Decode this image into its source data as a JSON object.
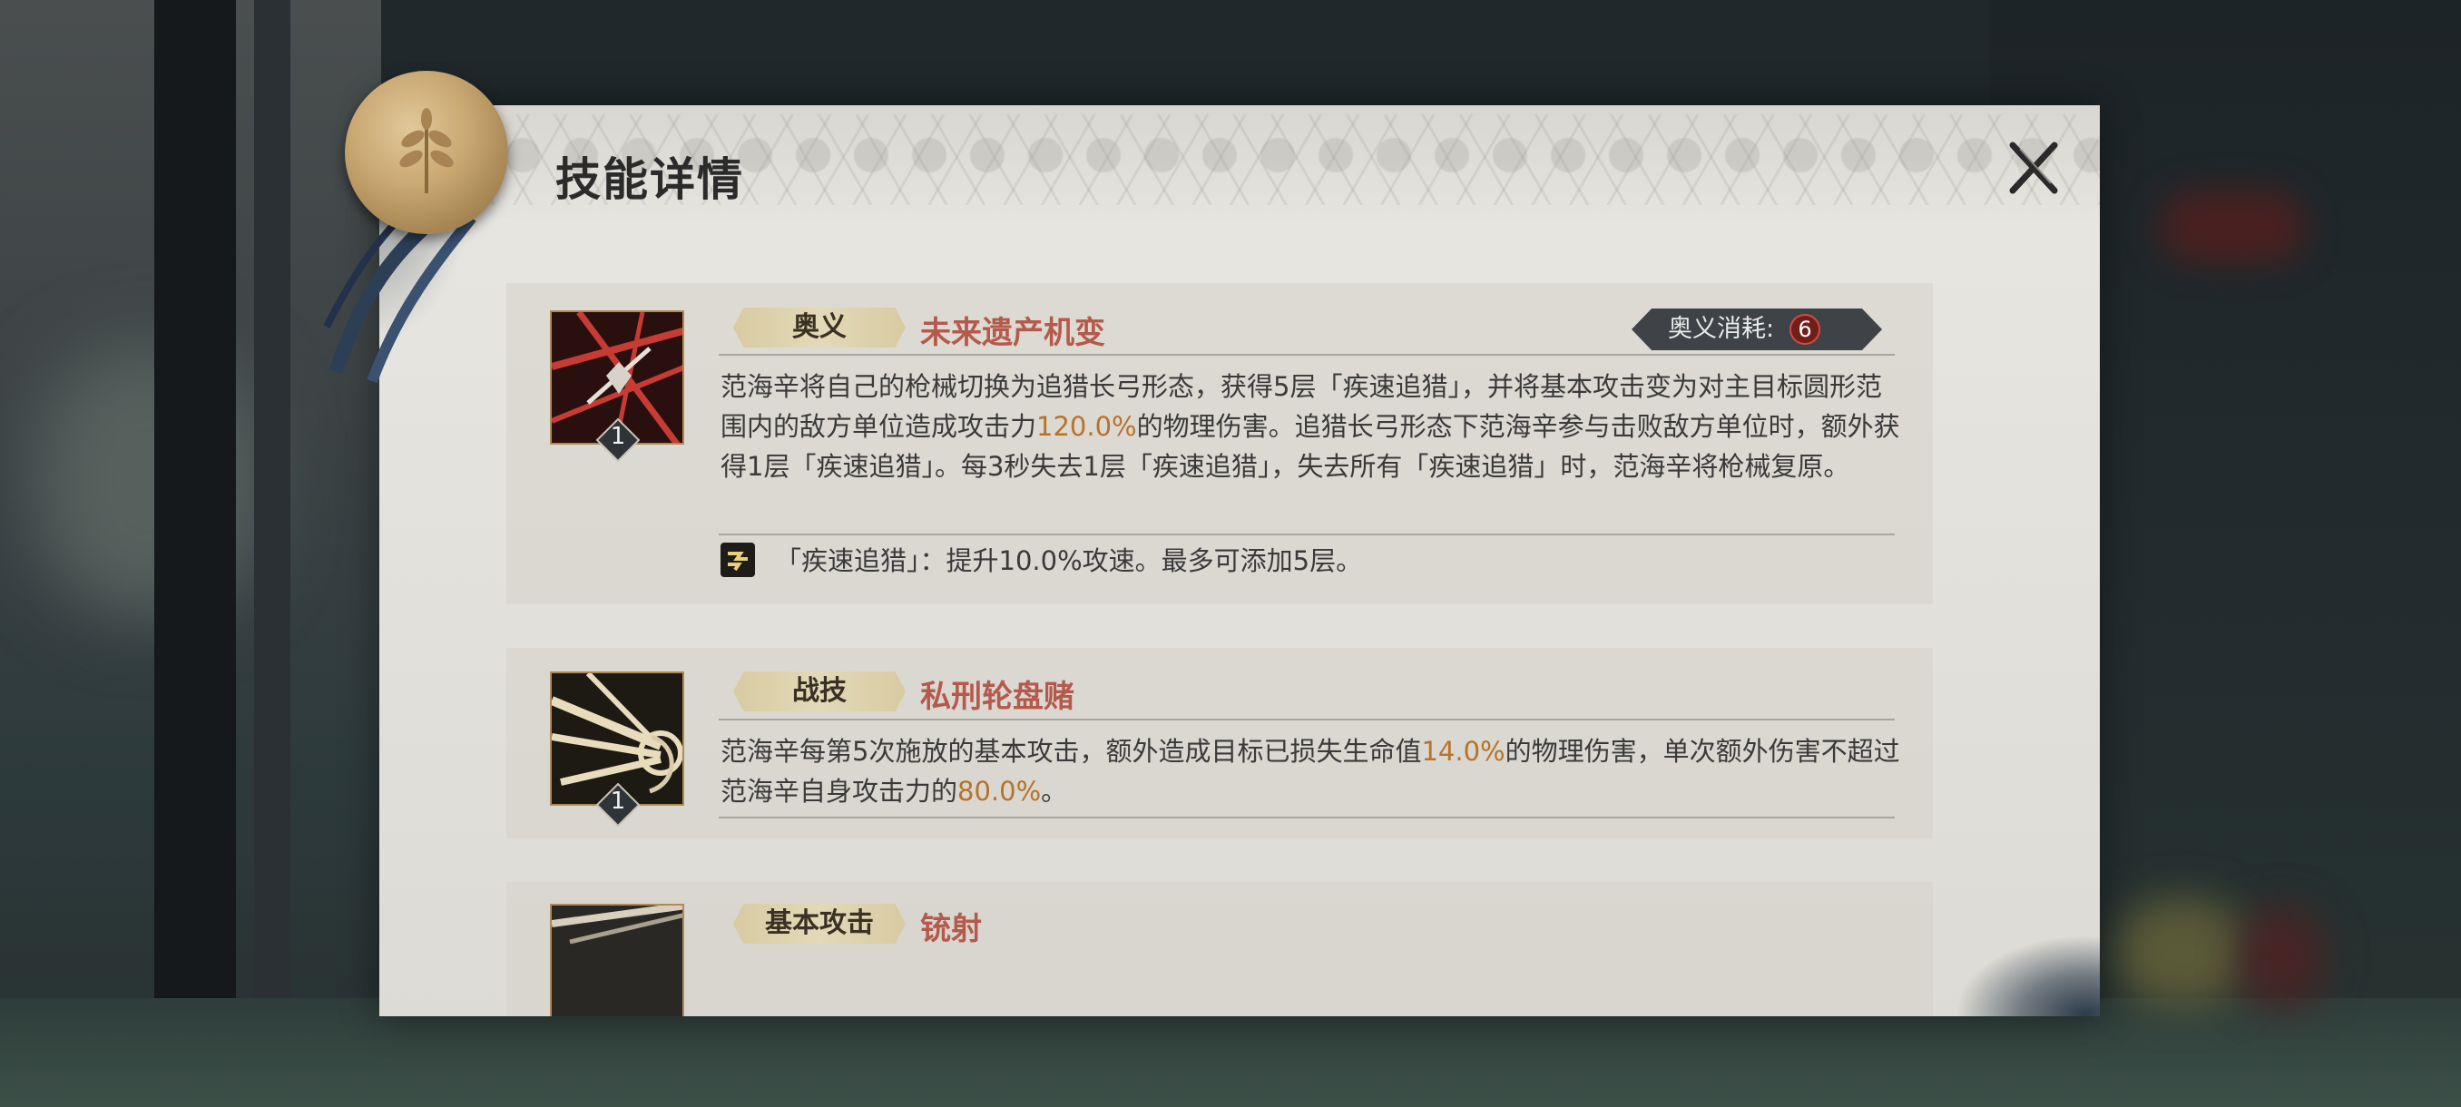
{
  "dialog": {
    "title": "技能详情"
  },
  "skills": [
    {
      "tag": "奥义",
      "name": "未来遗产机变",
      "level": "1",
      "cost_label": "奥义消耗:",
      "cost_value": "6",
      "desc_part1": "范海辛将自己的枪械切换为追猎长弓形态，获得5层「疾速追猎」，并将基本攻击变为对主目标圆形范围内的敌方单位造成攻击力",
      "desc_value1": "120.0%",
      "desc_part2": "的物理伤害。追猎长弓形态下范海辛参与击败敌方单位时，额外获得1层「疾速追猎」。每3秒失去1层「疾速追猎」，失去所有「疾速追猎」时，范海辛将枪械复原。",
      "buff_text": "「疾速追猎」：提升10.0%攻速。最多可添加5层。",
      "icon": "crossbow-skill-icon",
      "buff_icon": "speed-buff-icon"
    },
    {
      "tag": "战技",
      "name": "私刑轮盘赌",
      "level": "1",
      "desc_part1": "范海辛每第5次施放的基本攻击，额外造成目标已损失生命值",
      "desc_value1": "14.0%",
      "desc_part2": "的物理伤害，单次额外伤害不超过范海辛自身攻击力的",
      "desc_value2": "80.0%",
      "desc_part3": "。",
      "icon": "revolver-skill-icon"
    },
    {
      "tag": "基本攻击",
      "name": "铳射",
      "icon": "gunshot-skill-icon"
    }
  ],
  "colors": {
    "skill_name": "#b35a4c",
    "highlight_value": "#b7722b",
    "cost_badge": "#6f1e1a"
  }
}
